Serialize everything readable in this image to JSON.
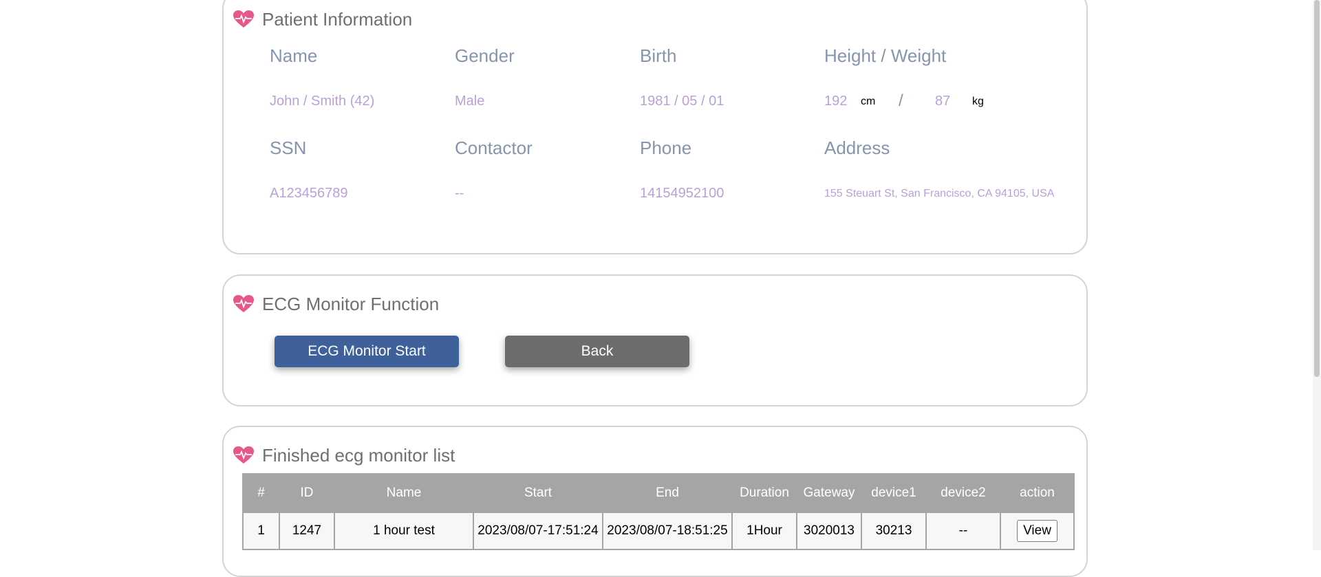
{
  "patient": {
    "title": "Patient Information",
    "labels": {
      "name": "Name",
      "gender": "Gender",
      "birth": "Birth",
      "height_weight": "Height / Weight",
      "ssn": "SSN",
      "contactor": "Contactor",
      "phone": "Phone",
      "address": "Address"
    },
    "values": {
      "name": "John / Smith (42)",
      "gender": "Male",
      "birth": "1981 / 05 / 01",
      "height": "192",
      "height_unit": "cm",
      "separator": "/",
      "weight": "87",
      "weight_unit": "kg",
      "ssn": "A123456789",
      "contactor": "--",
      "phone": "14154952100",
      "address": "155 Steuart St, San Francisco, CA 94105, USA"
    }
  },
  "ecg": {
    "title": "ECG Monitor Function",
    "start_label": "ECG Monitor Start",
    "back_label": "Back"
  },
  "list": {
    "title": "Finished ecg monitor list",
    "columns": [
      "#",
      "ID",
      "Name",
      "Start",
      "End",
      "Duration",
      "Gateway",
      "device1",
      "device2",
      "action"
    ],
    "rows": [
      {
        "num": "1",
        "id": "1247",
        "name": "1 hour test",
        "start": "2023/08/07-17:51:24",
        "end": "2023/08/07-18:51:25",
        "duration": "1Hour",
        "gateway": "3020013",
        "device1": "30213",
        "device2": "--",
        "action_label": "View"
      }
    ]
  },
  "colors": {
    "accent": "#3e619c",
    "heart": "#e8578a",
    "label": "#8595ad",
    "value": "#b9a0d9"
  },
  "icons": {
    "card_header": "heart-pulse-icon"
  }
}
